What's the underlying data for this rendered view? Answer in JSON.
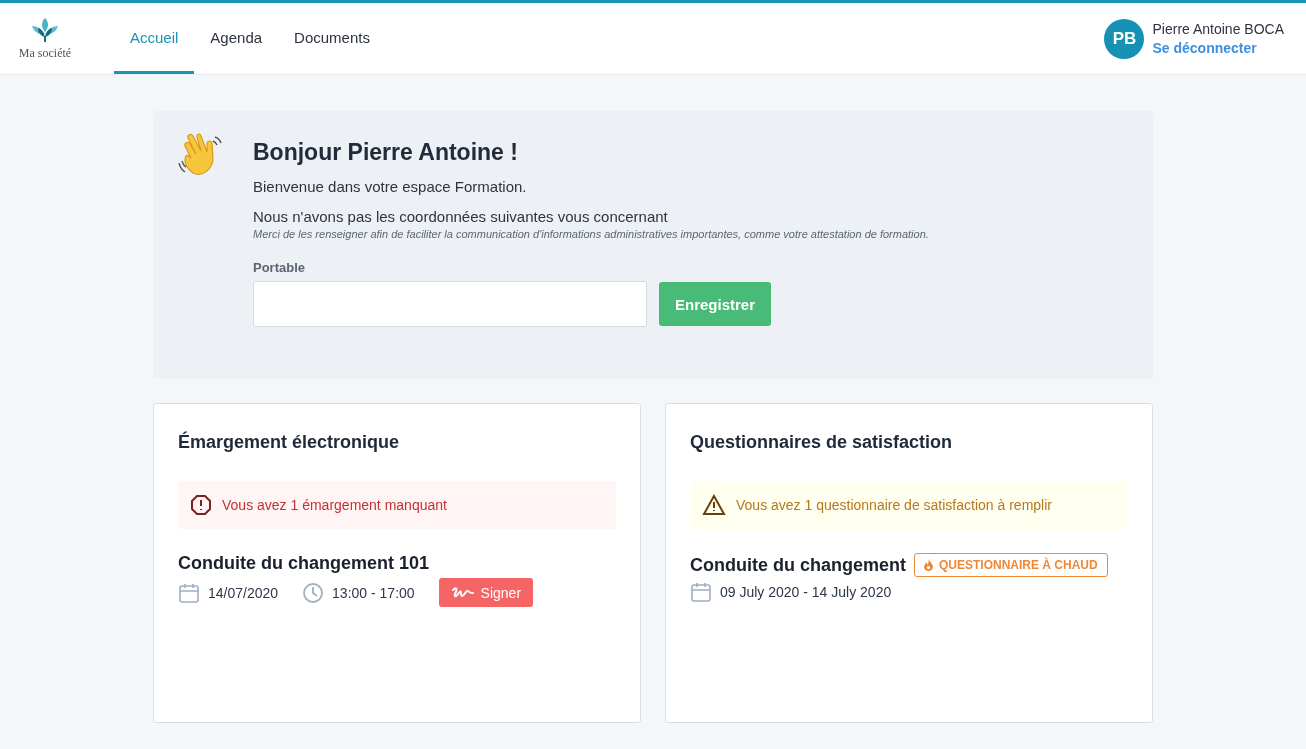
{
  "header": {
    "logo_text": "Ma société",
    "tabs": [
      {
        "label": "Accueil",
        "selected": true
      },
      {
        "label": "Agenda",
        "selected": false
      },
      {
        "label": "Documents",
        "selected": false
      }
    ],
    "user": {
      "initials": "PB",
      "name": "Pierre Antoine BOCA",
      "logout": "Se déconnecter"
    }
  },
  "welcome": {
    "title": "Bonjour Pierre Antoine !",
    "subtitle": "Bienvenue dans votre espace Formation.",
    "notice": "Nous n'avons pas les coordonnées suivantes vous concernant",
    "hint": "Merci de les renseigner afin de faciliter la communication d'informations administratives importantes, comme votre attestation de formation.",
    "field_label": "Portable",
    "button": "Enregistrer"
  },
  "cards": [
    {
      "title": "Émargement électronique",
      "alert": {
        "kind": "error",
        "text": "Vous avez 1 émargement manquant"
      },
      "item": {
        "title": "Conduite du changement 101",
        "date": "14/07/2020",
        "time": "13:00 - 17:00",
        "action": "Signer"
      }
    },
    {
      "title": "Questionnaires de satisfaction",
      "alert": {
        "kind": "warning",
        "text": "Vous avez 1 questionnaire de satisfaction à remplir"
      },
      "item": {
        "title": "Conduite du changement",
        "badge": "QUESTIONNAIRE À CHAUD",
        "date": "09 July 2020 - 14 July 2020"
      }
    }
  ]
}
